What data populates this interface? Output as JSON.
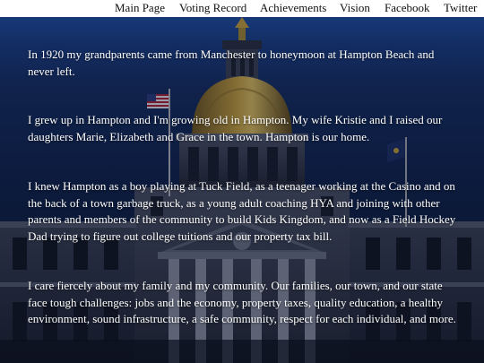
{
  "nav": {
    "items": [
      "Main Page",
      "Voting Record",
      "Achievements",
      "Vision",
      "Facebook",
      "Twitter"
    ]
  },
  "content": {
    "paragraphs": [
      "In 1920 my grandparents came from Manchester to honeymoon at Hampton Beach and never left.",
      "I grew up in Hampton and I'm growing old in Hampton. My wife Kristie and I raised our daughters Marie, Elizabeth and Grace in the town. Hampton is our home.",
      "I knew Hampton as a boy playing at Tuck Field, as a teenager working at the Casino and on the back of a town garbage truck, as a young adult coaching HYA and joining with other parents and members of the community to build Kids Kingdom, and now as a Field Hockey Dad trying to figure out college tuitions and our property tax bill.",
      "I care fiercely about my family and my community. Our families, our town, and our state face tough challenges: jobs and the economy, property taxes, quality education, a healthy environment, sound infrastructure, a safe community, respect for each individual, and more."
    ]
  },
  "colors": {
    "nav_background": "#ffffff",
    "nav_text": "#111111",
    "sky_top": "#1f4ea0",
    "sky_bottom": "#0a1630",
    "dome_gold": "#b8922e",
    "text": "#ffffff"
  },
  "icons": {
    "background": "capitol-building-image",
    "flag_left": "american-flag",
    "flag_right": "state-flag"
  }
}
